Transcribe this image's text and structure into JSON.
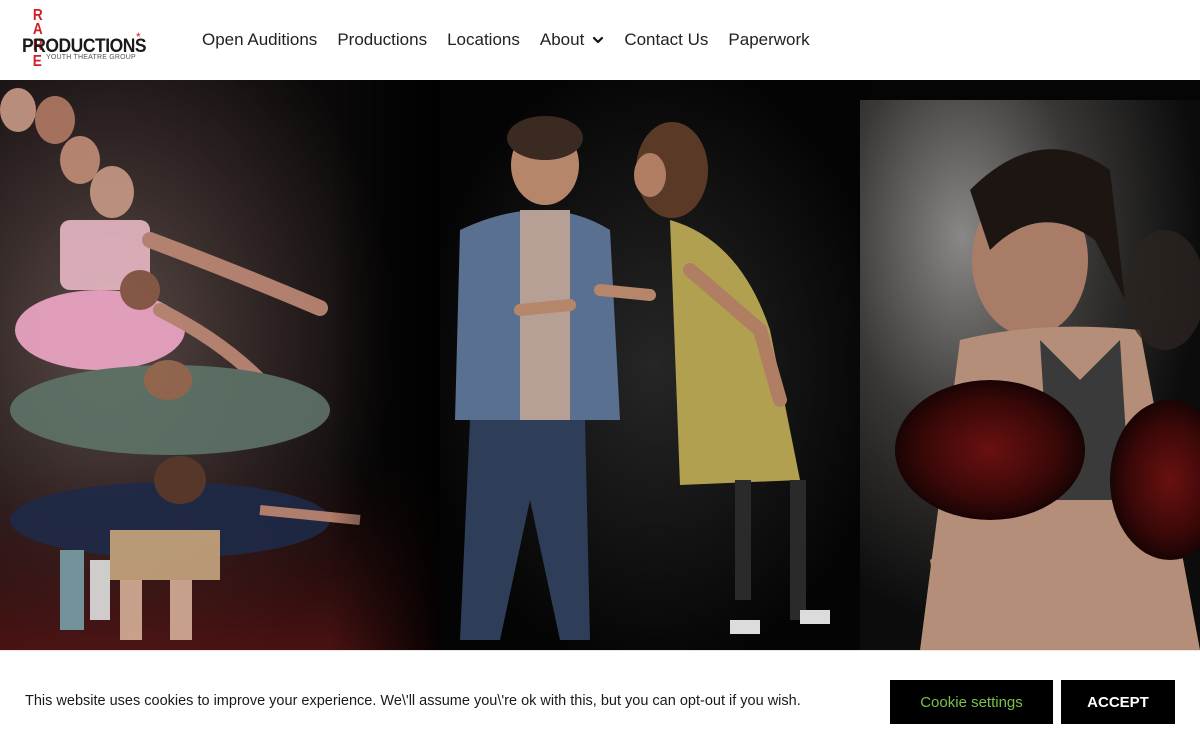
{
  "logo": {
    "rare_letters": [
      "R",
      "A",
      "R",
      "E"
    ],
    "wordmark": "PRODUCTIONS",
    "star": "*",
    "tagline": "YOUTH THEATRE GROUP"
  },
  "nav": {
    "items": [
      {
        "label": "Open Auditions"
      },
      {
        "label": "Productions"
      },
      {
        "label": "Locations"
      },
      {
        "label": "About"
      },
      {
        "label": "Contact Us"
      },
      {
        "label": "Paperwork"
      }
    ]
  },
  "cookie_banner": {
    "message": "This website uses cookies to improve your experience. We\\'ll assume you\\'re ok with this, but you can opt-out if you wish.",
    "settings_label": "Cookie settings",
    "accept_label": "ACCEPT"
  },
  "colors": {
    "brand_red": "#d0202a",
    "settings_text": "#7bc04a",
    "button_bg": "#000000"
  }
}
